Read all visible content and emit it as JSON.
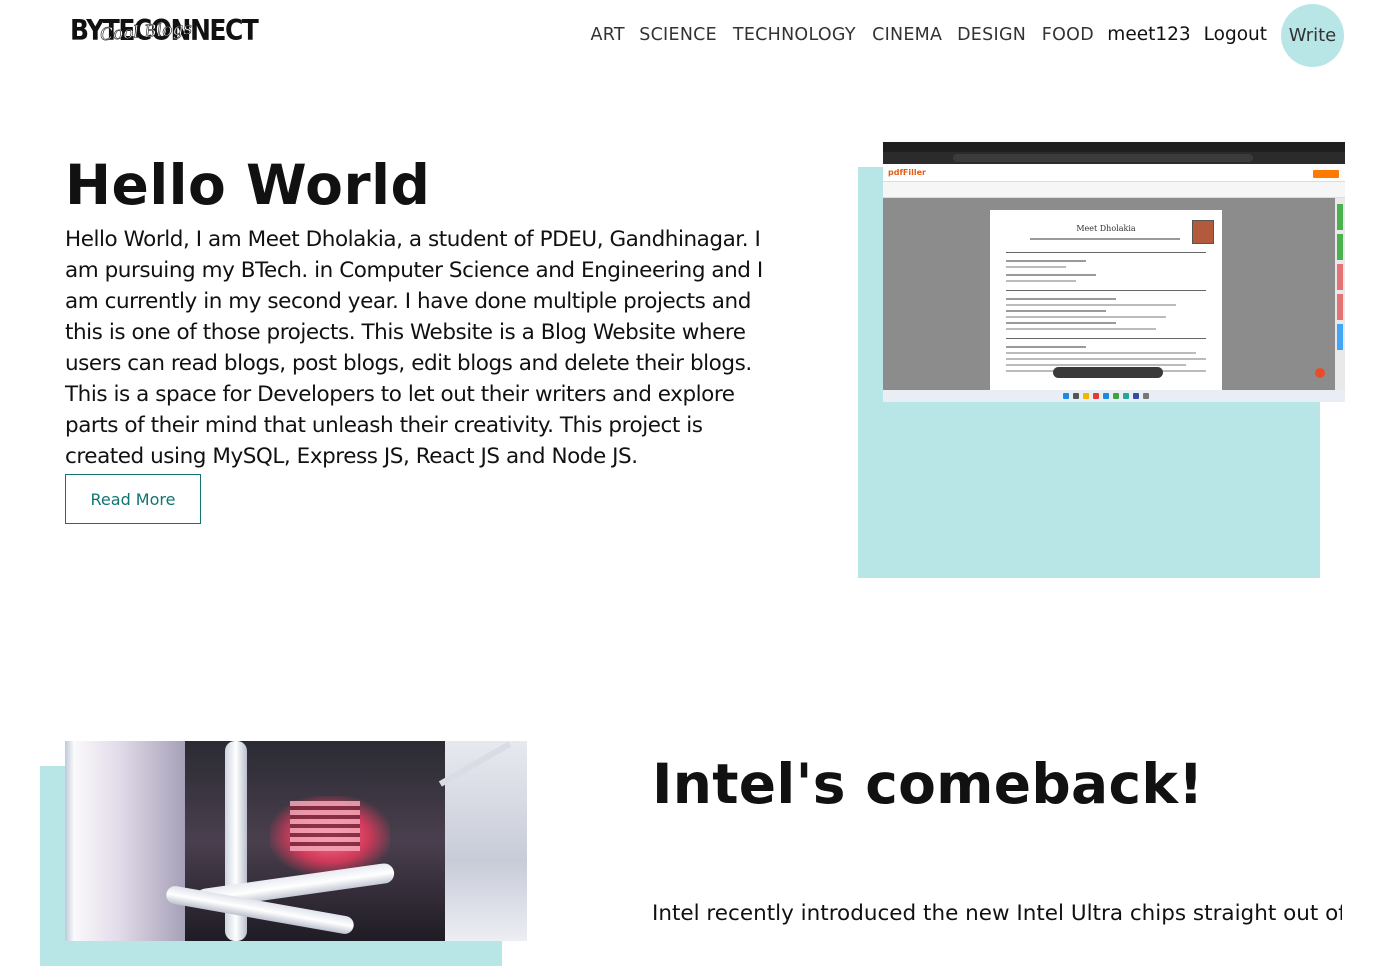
{
  "logo": {
    "text": "BYTECONNECT",
    "script": "Cool Blogs"
  },
  "nav": {
    "categories": [
      "ART",
      "SCIENCE",
      "TECHNOLOGY",
      "CINEMA",
      "DESIGN",
      "FOOD"
    ],
    "username": "meet123",
    "logout_label": "Logout",
    "write_label": "Write"
  },
  "posts": [
    {
      "title": "Hello World",
      "description": "Hello World, I am Meet Dholakia, a student of PDEU, Gandhinagar. I am pursuing my BTech. in Computer Science and Engineering and I am currently in my second year. I have done multiple projects and this is one of those projects. This Website is a Blog Website where users can read blogs, post blogs, edit blogs and delete their blogs. This is a space for Developers to let out their writers and explore parts of their mind that unleash their creativity. This project is created using MySQL, Express JS, React JS and Node JS.",
      "read_more_label": "Read More",
      "image": {
        "app_name": "pdfFiller",
        "document_name": "Meet Dholakia"
      }
    },
    {
      "title": "Intel's comeback!",
      "description": "Intel recently introduced the new Intel Ultra chips straight out of"
    }
  ],
  "colors": {
    "accent_bg": "#b8e5e6",
    "button_border": "#127373",
    "text": "#111111"
  }
}
